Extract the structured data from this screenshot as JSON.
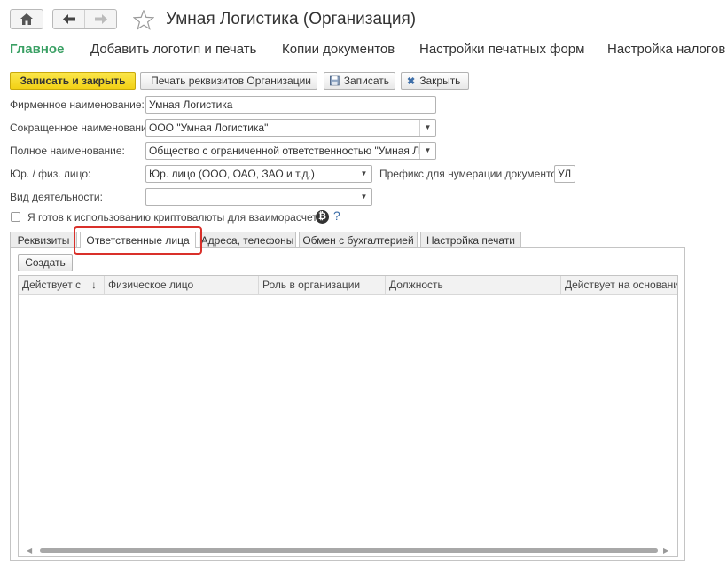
{
  "window": {
    "title": "Умная Логистика (Организация)"
  },
  "nav": {
    "home_icon": "home-icon",
    "back_icon": "arrow-left-icon",
    "forward_icon": "arrow-right-icon",
    "favorite_icon": "star-icon"
  },
  "menu": [
    {
      "label": "Главное",
      "active": true
    },
    {
      "label": "Добавить логотип и печать"
    },
    {
      "label": "Копии документов"
    },
    {
      "label": "Настройки печатных форм"
    },
    {
      "label": "Настройка налогов"
    }
  ],
  "toolbar": {
    "save_close": "Записать и закрыть",
    "print_details": "Печать реквизитов Организации",
    "save": "Записать",
    "close": "Закрыть"
  },
  "form": {
    "brand_name_label": "Фирменное наименование:",
    "brand_name_value": "Умная Логистика",
    "short_name_label": "Сокращенное наименование:",
    "short_name_value": "ООО \"Умная Логистика\"",
    "full_name_label": "Полное наименование:",
    "full_name_value": "Общество с ограниченной ответственностью \"Умная Логи",
    "entity_type_label": "Юр. / физ. лицо:",
    "entity_type_value": "Юр. лицо (ООО, ОАО, ЗАО и т.д.)",
    "prefix_label": "Префикс для нумерации документов :",
    "prefix_value": "УЛ",
    "activity_label": "Вид деятельности:",
    "activity_value": "",
    "crypto_label": "Я готов к использованию криптовалюты для взаиморасчетов",
    "crypto_checked": false,
    "help_label": "?"
  },
  "tabs": [
    {
      "label": "Реквизиты"
    },
    {
      "label": "Ответственные лица",
      "active": true
    },
    {
      "label": "Адреса, телефоны"
    },
    {
      "label": "Обмен с бухгалтерией"
    },
    {
      "label": "Настройка печати"
    }
  ],
  "responsible": {
    "create_button": "Создать",
    "columns": [
      "Действует с",
      "Физическое лицо",
      "Роль в организации",
      "Должность",
      "Действует на основании"
    ],
    "sort_indicator": "↓",
    "rows": []
  },
  "colors": {
    "accent_green": "#3aa064",
    "primary_button": "#f2d115",
    "highlight_red": "#d9302a"
  }
}
